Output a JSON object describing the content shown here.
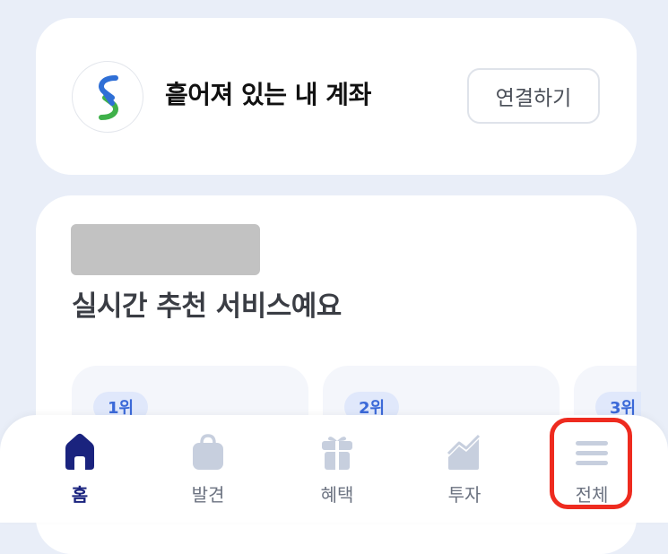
{
  "account": {
    "title": "흩어져 있는 내 계좌",
    "connect_label": "연결하기"
  },
  "recommend": {
    "title": "실시간 추천 서비스예요",
    "ranks": [
      "1위",
      "2위",
      "3위"
    ]
  },
  "tabs": [
    {
      "label": "홈",
      "icon": "home-icon",
      "active": true
    },
    {
      "label": "발견",
      "icon": "bag-icon",
      "active": false
    },
    {
      "label": "혜택",
      "icon": "gift-icon",
      "active": false
    },
    {
      "label": "투자",
      "icon": "chart-icon",
      "active": false
    },
    {
      "label": "전체",
      "icon": "menu-icon",
      "active": false
    }
  ],
  "colors": {
    "background": "#e9eef8",
    "active_tab": "#1a237e",
    "inactive_icon": "#c7cfde",
    "highlight": "#ee2b1f",
    "rank_badge_text": "#3b69d8"
  }
}
